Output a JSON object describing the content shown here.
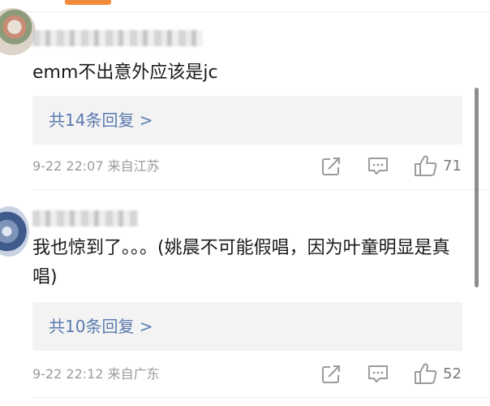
{
  "comments": [
    {
      "content": "emm不出意外应该是jc",
      "replies_label": "共14条回复 >",
      "meta": "9-22 22:07  来自江苏",
      "likes": "71"
    },
    {
      "content": "我也惊到了。。。(姚晨不可能假唱，因为叶童明显是真唱)",
      "replies_label": "共10条回复 >",
      "meta": "9-22 22:12  来自广东",
      "likes": "52"
    }
  ],
  "icons": {
    "share": "share-icon",
    "comment": "comment-icon",
    "like": "thumbs-up-icon"
  },
  "colors": {
    "accent": "#f08a3c",
    "reply_link": "#5b7ab0",
    "meta": "#9b9b9b"
  }
}
